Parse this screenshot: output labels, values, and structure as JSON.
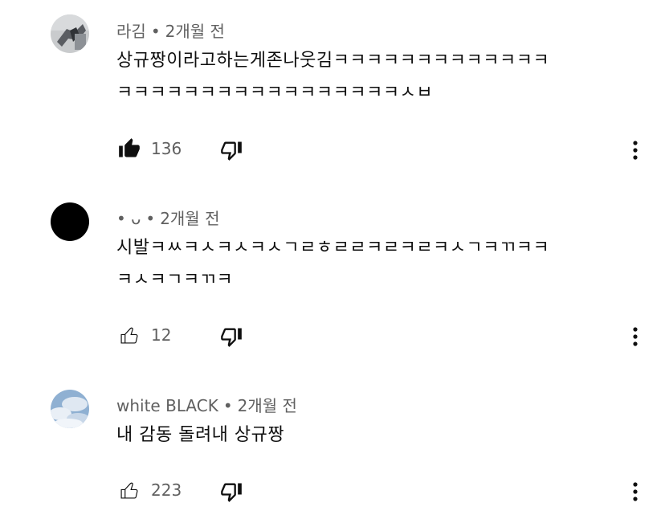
{
  "comments": [
    {
      "author": "라김",
      "time": "2개월 전",
      "text_line1": "상규짱이라고하는게존나웃김ㅋㅋㅋㅋㅋㅋㅋㅋㅋㅋㅋㅋㅋ",
      "text_line2": "ㅋㅋㅋㅋㅋㅋㅋㅋㅋㅋㅋㅋㅋㅋㅋㅋㅋㅅㅂ",
      "likes": "136",
      "liked": true
    },
    {
      "author": "• ᴗ",
      "time": "2개월 전",
      "text_line1": "시발ㅋㅆㅋㅅㅋㅅㅋㅅㄱㄹㅎㄹㄹㅋㄹㅋㄹㅋㅅㄱㅋㄲㅋㅋ",
      "text_line2": "ㅋㅅㅋㄱㅋㄲㅋ",
      "likes": "12",
      "liked": false
    },
    {
      "author": "white BLACK",
      "time": "2개월 전",
      "text_line1": "내 감동 돌려내 상규짱",
      "text_line2": "",
      "likes": "223",
      "liked": false
    }
  ],
  "separator": "•",
  "icons": {
    "like": "thumb-up-icon",
    "dislike": "thumb-down-icon",
    "more": "more-vert-icon"
  }
}
